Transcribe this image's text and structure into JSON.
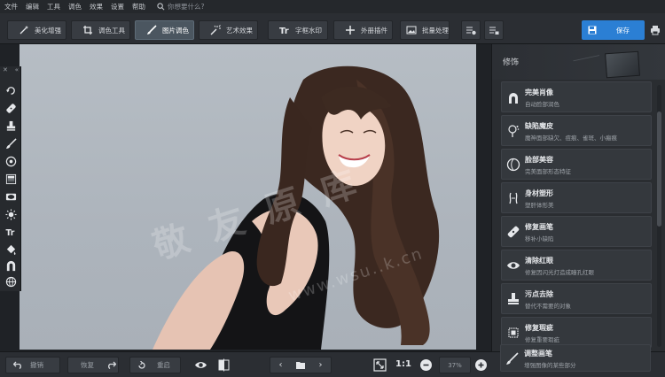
{
  "menu": {
    "items": [
      "文件",
      "编辑",
      "工具",
      "调色",
      "效果",
      "设置",
      "帮助"
    ],
    "search_placeholder": "你想要什么?"
  },
  "toolbar": {
    "tabs": [
      {
        "label": "美化增强",
        "icon": "sparkle-wand-icon"
      },
      {
        "label": "调色工具",
        "icon": "crop-icon"
      },
      {
        "label": "图片调色",
        "icon": "brush-icon",
        "active": true
      },
      {
        "label": "艺术效果",
        "icon": "magic-wand-icon"
      },
      {
        "label": "字框水印",
        "icon": "text-icon"
      },
      {
        "label": "外册插件",
        "icon": "plus-icon"
      },
      {
        "label": "批量处理",
        "icon": "batch-image-icon"
      }
    ],
    "save_label": "保存"
  },
  "tools": [
    "rotate-icon",
    "healing-patch-icon",
    "stamp-icon",
    "brush-icon",
    "target-icon",
    "gradient-icon",
    "vignette-icon",
    "brightness-icon",
    "text-icon",
    "bucket-icon",
    "magnet-lasso-icon",
    "sphere-icon"
  ],
  "panel": {
    "title": "修饰",
    "features": [
      {
        "title": "完美肖像",
        "subtitle": "自动脸部润色",
        "icon": "face-icon"
      },
      {
        "title": "缺陷魔皮",
        "subtitle": "魔神面部缺欠、痘痕、雀斑、小瘢痕",
        "icon": "spot-brush-icon"
      },
      {
        "title": "脸部美容",
        "subtitle": "完美面部形态特征",
        "icon": "face-outline-icon"
      },
      {
        "title": "身材塑形",
        "subtitle": "塑肝体形美",
        "icon": "body-shape-icon"
      },
      {
        "title": "修复画笔",
        "subtitle": "移补小缺陷",
        "icon": "bandage-icon"
      },
      {
        "title": "清除红眼",
        "subtitle": "修复因闪光灯造成瞳孔红眼",
        "icon": "eye-icon"
      },
      {
        "title": "污点去除",
        "subtitle": "替代不需要的对象",
        "icon": "clone-stamp-icon"
      },
      {
        "title": "修复瑕疵",
        "subtitle": "修复重要瑕疵",
        "icon": "chip-icon"
      },
      {
        "title": "调整画笔",
        "subtitle": "增强图像的某些部分",
        "icon": "adjust-brush-icon"
      }
    ]
  },
  "bottom": {
    "undo_label": "撤销",
    "redo_label": "恢复",
    "reset_label": "重启",
    "one_to_one": "1:1",
    "zoom_value": "37%"
  },
  "watermark": {
    "text": "敬 友 原 库",
    "url": "www.wsu..k.cn"
  }
}
